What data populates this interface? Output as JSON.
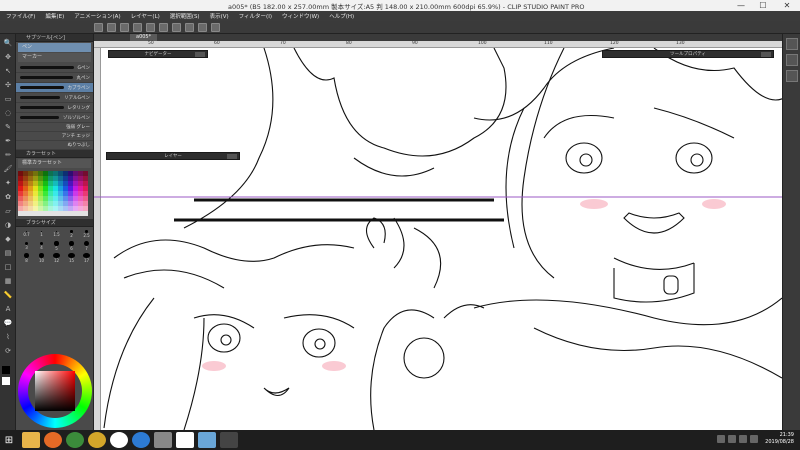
{
  "window": {
    "title": "a005* (B5 182.00 x 257.00mm 製本サイズ:A5 判 148.00 x 210.00mm 600dpi 65.9%) - CLIP STUDIO PAINT PRO",
    "min": "—",
    "max": "☐",
    "close": "✕"
  },
  "menu": [
    "ファイル(F)",
    "編集(E)",
    "アニメーション(A)",
    "レイヤー(L)",
    "選択範囲(S)",
    "表示(V)",
    "フィルター(I)",
    "ウィンドウ(W)",
    "ヘルプ(H)"
  ],
  "sidebar": {
    "subtool_header": "サブツール[ペン]",
    "subtool_tabs": [
      "ペン",
      "マーカー"
    ],
    "brushes": [
      {
        "label": "Gペン"
      },
      {
        "label": "丸ペン"
      },
      {
        "label": "カブラペン"
      },
      {
        "label": "リアルGペン"
      },
      {
        "label": "レタリング"
      },
      {
        "label": "ゾルゾルペン"
      }
    ],
    "props": [
      "強弱 グレー",
      "アンチ エッジ",
      "ぬりつぶし"
    ],
    "palette_header": "カラーセット",
    "palette_sub": "標準カラーセット",
    "size_header": "ブラシサイズ",
    "size_labels": [
      "0.7",
      "1",
      "1.5",
      "2",
      "2.5",
      "3",
      "4",
      "5",
      "6",
      "7",
      "8",
      "10",
      "12",
      "15",
      "17"
    ]
  },
  "canvas": {
    "tab_label": "a005*",
    "ruler_marks": [
      "50",
      "60",
      "70",
      "80",
      "90",
      "100",
      "110",
      "120",
      "130"
    ],
    "nav_panel": "ナビゲーター",
    "layer_panel": "レイヤー",
    "tool_property_panel": "ツールプロパティ"
  },
  "taskbar": {
    "time": "21:39",
    "date": "2019/08/28"
  }
}
